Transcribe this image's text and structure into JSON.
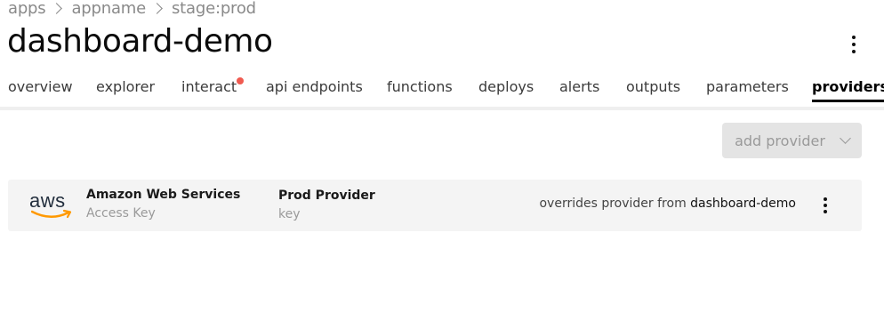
{
  "breadcrumb": [
    "apps",
    "appname",
    "stage:prod"
  ],
  "page_title": "dashboard-demo",
  "tabs": [
    {
      "label": "overview"
    },
    {
      "label": "explorer"
    },
    {
      "label": "interact",
      "notification": true
    },
    {
      "label": "api endpoints"
    },
    {
      "label": "functions"
    },
    {
      "label": "deploys"
    },
    {
      "label": "alerts"
    },
    {
      "label": "outputs"
    },
    {
      "label": "parameters"
    },
    {
      "label": "providers",
      "active": true
    }
  ],
  "add_provider_label": "add provider",
  "providers": [
    {
      "logo_text": "aws",
      "logo_icon": "aws-logo",
      "service_name": "Amazon Web Services",
      "service_type": "Access Key",
      "provider_name": "Prod Provider",
      "provider_type": "key",
      "override_prefix": "overrides provider from",
      "override_app": "dashboard-demo"
    }
  ],
  "colors": {
    "notification_dot": "#f05a50",
    "row_background": "#f4f4f4",
    "aws_smile": "#ff9900",
    "disabled_button": "#e4e4e4"
  }
}
